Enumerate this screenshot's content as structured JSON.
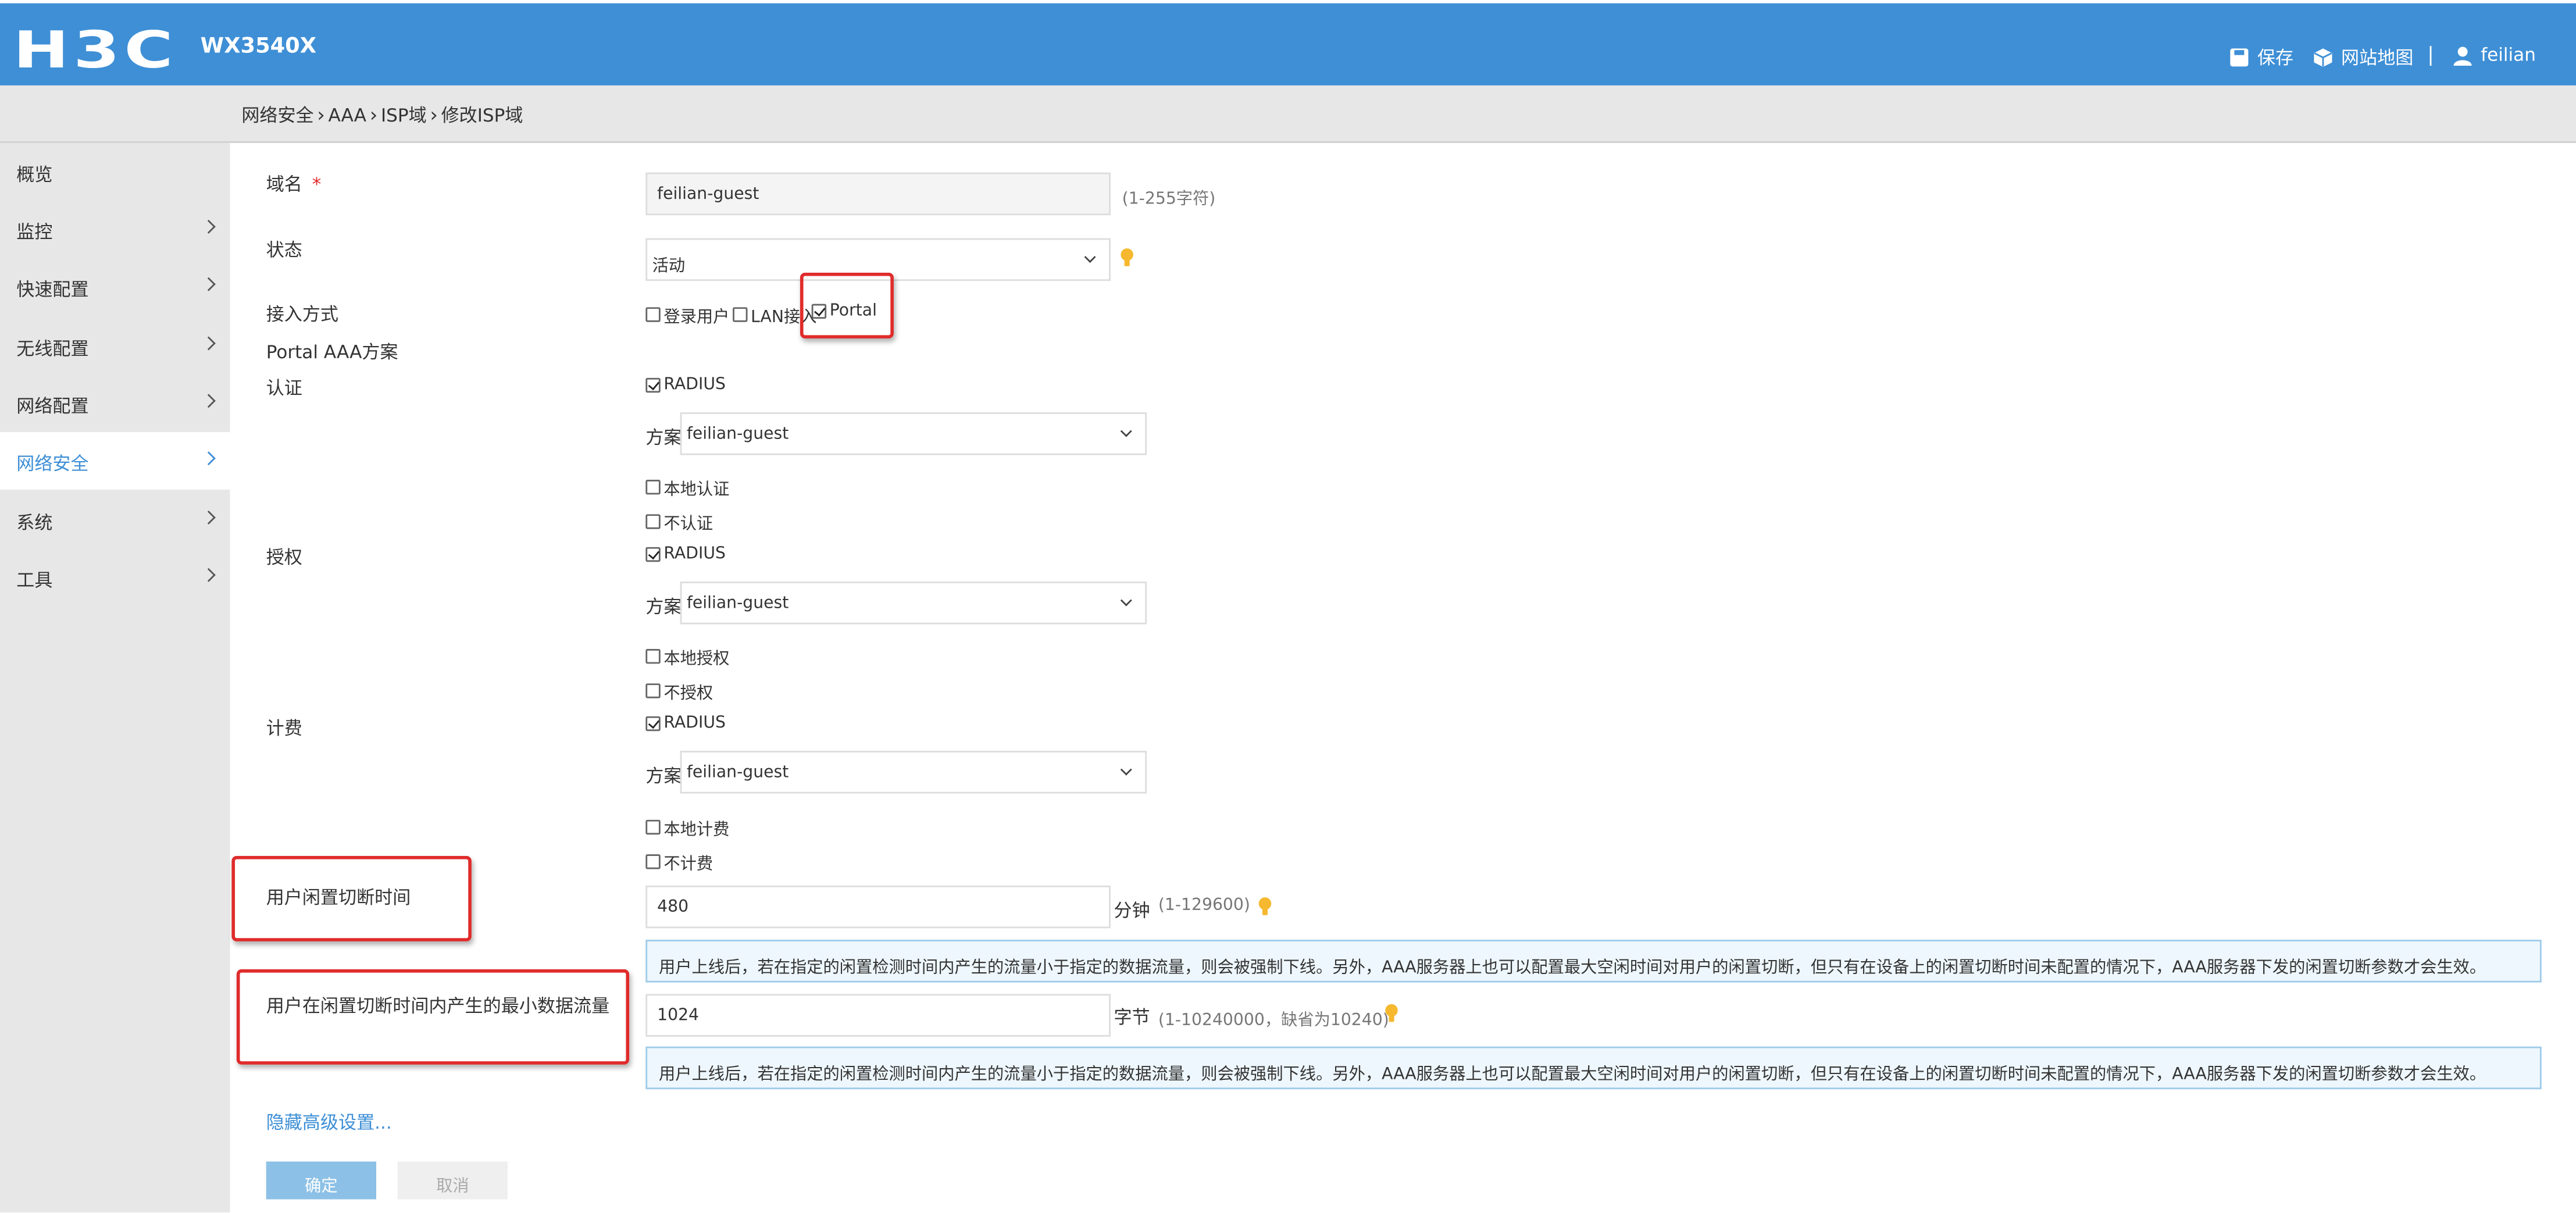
{
  "header": {
    "brand": "H3C",
    "model": "WX3540X",
    "save_label": "保存",
    "sitemap_label": "网站地图",
    "username": "feilian",
    "icons": [
      "save-icon",
      "cube-icon",
      "user-icon"
    ],
    "colors": {
      "bar": "#3e8fd6",
      "text": "#ffffff"
    }
  },
  "breadcrumb": [
    "网络安全",
    "AAA",
    "ISP域",
    "修改ISP域"
  ],
  "sidebar": {
    "items": [
      {
        "label": "概览",
        "has_arrow": false
      },
      {
        "label": "监控",
        "has_arrow": true
      },
      {
        "label": "快速配置",
        "has_arrow": true
      },
      {
        "label": "无线配置",
        "has_arrow": true
      },
      {
        "label": "网络配置",
        "has_arrow": true
      },
      {
        "label": "网络安全",
        "has_arrow": true,
        "active": true
      },
      {
        "label": "系统",
        "has_arrow": true
      },
      {
        "label": "工具",
        "has_arrow": true
      }
    ]
  },
  "form": {
    "domain": {
      "label": "域名",
      "required_mark": "*",
      "value": "feilian-guest",
      "hint": "(1-255字符)"
    },
    "status": {
      "label": "状态",
      "value": "活动"
    },
    "access": {
      "label": "接入方式",
      "options": [
        {
          "label": "登录用户",
          "checked": false
        },
        {
          "label": "LAN接入",
          "checked": false
        },
        {
          "label": "Portal",
          "checked": true
        }
      ]
    },
    "portal_aaa_title": "Portal AAA方案",
    "auth": {
      "label": "认证",
      "radius": {
        "label": "RADIUS",
        "checked": true
      },
      "plan_label": "方案",
      "plan_value": "feilian-guest",
      "local": {
        "label": "本地认证",
        "checked": false
      },
      "none": {
        "label": "不认证",
        "checked": false
      }
    },
    "authz": {
      "label": "授权",
      "radius": {
        "label": "RADIUS",
        "checked": true
      },
      "plan_label": "方案",
      "plan_value": "feilian-guest",
      "local": {
        "label": "本地授权",
        "checked": false
      },
      "none": {
        "label": "不授权",
        "checked": false
      }
    },
    "acct": {
      "label": "计费",
      "radius": {
        "label": "RADIUS",
        "checked": true
      },
      "plan_label": "方案",
      "plan_value": "feilian-guest",
      "local": {
        "label": "本地计费",
        "checked": false
      },
      "none": {
        "label": "不计费",
        "checked": false
      }
    },
    "idle_time": {
      "label": "用户闲置切断时间",
      "value": "480",
      "unit": "分钟",
      "hint": "(1-129600)"
    },
    "idle_flow": {
      "label": "用户在闲置切断时间内产生的最小数据流量",
      "value": "1024",
      "unit": "字节",
      "hint": "(1-10240000，缺省为10240)"
    },
    "info_text": "用户上线后，若在指定的闲置检测时间内产生的流量小于指定的数据流量，则会被强制下线。另外，AAA服务器上也可以配置最大空闲时间对用户的闲置切断，但只有在设备上的闲置切断时间未配置的情况下，AAA服务器下发的闲置切断参数才会生效。",
    "advanced_link": "隐藏高级设置...",
    "ok_label": "确定",
    "cancel_label": "取消"
  },
  "colors": {
    "accent": "#3e8fd6",
    "highlight_box": "#e02b2b",
    "info_bg": "#eef7fd",
    "bulb": "#f5b82e"
  }
}
